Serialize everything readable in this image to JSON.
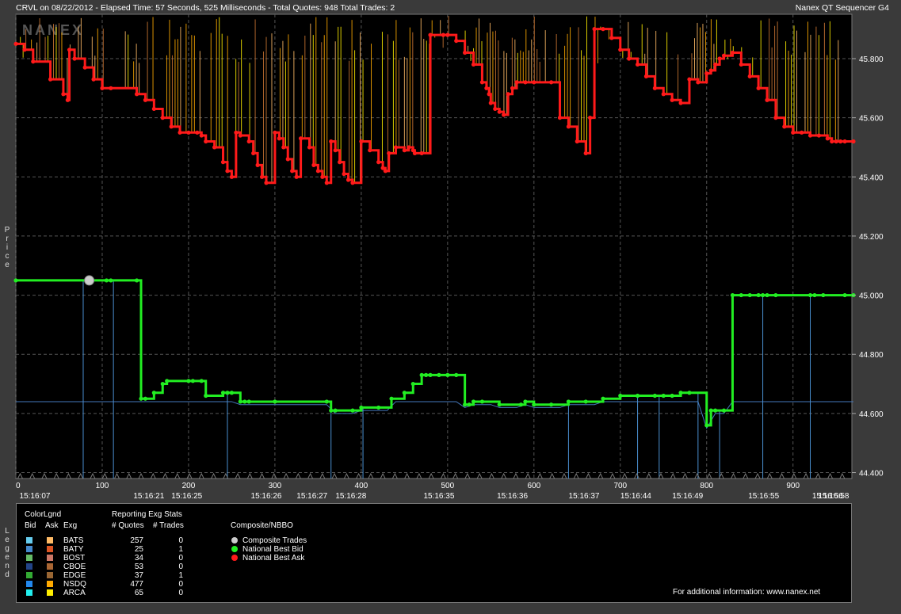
{
  "header": {
    "left": "CRVL on 08/22/2012  -  Elapsed Time: 57 Seconds, 525 Milliseconds  -  Total Quotes: 948  Total Trades: 2",
    "right": "Nanex QT Sequencer G4",
    "watermark": "NANEX"
  },
  "side_labels": {
    "price": "Price",
    "legend": "Legend"
  },
  "chart_data": {
    "type": "line",
    "xlim": [
      0,
      970
    ],
    "ylim": [
      44.38,
      45.95
    ],
    "ytick_values": [
      44.4,
      44.6,
      44.8,
      45.0,
      45.2,
      45.4,
      45.6,
      45.8
    ],
    "ytick_labels": [
      "44.400",
      "44.600",
      "44.800",
      "45.000",
      "45.200",
      "45.400",
      "45.600",
      "45.800"
    ],
    "xtick_values": [
      0,
      100,
      200,
      300,
      400,
      500,
      600,
      700,
      800,
      900
    ],
    "xtick_labels": [
      "0",
      "100",
      "200",
      "300",
      "400",
      "500",
      "600",
      "700",
      "800",
      "900"
    ],
    "time_tick_values": [
      8,
      154,
      198,
      290,
      343,
      388,
      490,
      575,
      658,
      718,
      778,
      866,
      940,
      985
    ],
    "time_labels": [
      "15:16:07",
      "15:16:21",
      "15:16:25",
      "15:16:26",
      "15:16:27",
      "15:16:28",
      "15:16:35",
      "15:16:36",
      "15:16:37",
      "15:16:44",
      "15:16:49",
      "15:16:55",
      "15:16:56",
      "15:16:58"
    ],
    "grid": true,
    "series": [
      {
        "name": "National Best Bid",
        "color": "#22ee22",
        "x": [
          0,
          105,
          110,
          140,
          145,
          150,
          160,
          170,
          175,
          200,
          205,
          215,
          220,
          240,
          245,
          250,
          260,
          265,
          270,
          300,
          360,
          365,
          370,
          390,
          400,
          420,
          435,
          450,
          460,
          470,
          475,
          480,
          490,
          500,
          510,
          520,
          525,
          530,
          540,
          560,
          585,
          590,
          600,
          620,
          640,
          660,
          680,
          700,
          720,
          740,
          750,
          760,
          770,
          780,
          800,
          805,
          810,
          820,
          830,
          840,
          850,
          860,
          865,
          870,
          880,
          920,
          925,
          935,
          960,
          970
        ],
        "y": [
          45.05,
          45.05,
          45.05,
          45.05,
          44.65,
          44.65,
          44.67,
          44.7,
          44.71,
          44.71,
          44.71,
          44.71,
          44.66,
          44.67,
          44.67,
          44.67,
          44.64,
          44.64,
          44.64,
          44.64,
          44.64,
          44.61,
          44.61,
          44.61,
          44.62,
          44.62,
          44.65,
          44.67,
          44.7,
          44.73,
          44.73,
          44.73,
          44.73,
          44.73,
          44.73,
          44.63,
          44.63,
          44.64,
          44.64,
          44.63,
          44.63,
          44.64,
          44.63,
          44.63,
          44.64,
          44.64,
          44.65,
          44.66,
          44.66,
          44.66,
          44.66,
          44.66,
          44.67,
          44.67,
          44.56,
          44.61,
          44.61,
          44.61,
          45.0,
          45.0,
          45.0,
          45.0,
          45.0,
          45.0,
          45.0,
          45.0,
          45.0,
          45.0,
          45.0,
          45.0
        ]
      },
      {
        "name": "National Best Ask",
        "color": "#ff1a1a",
        "x": [
          0,
          10,
          20,
          40,
          55,
          60,
          62,
          68,
          80,
          90,
          100,
          110,
          140,
          150,
          160,
          170,
          180,
          190,
          200,
          210,
          215,
          220,
          230,
          240,
          245,
          250,
          255,
          260,
          270,
          275,
          280,
          285,
          290,
          300,
          305,
          310,
          315,
          320,
          325,
          330,
          340,
          345,
          350,
          355,
          360,
          365,
          370,
          375,
          380,
          385,
          390,
          400,
          410,
          420,
          425,
          428,
          432,
          440,
          450,
          455,
          460,
          462,
          470,
          480,
          495,
          500,
          510,
          520,
          530,
          540,
          545,
          548,
          550,
          555,
          560,
          565,
          570,
          575,
          580,
          590,
          600,
          620,
          630,
          640,
          650,
          660,
          665,
          670,
          680,
          690,
          700,
          710,
          720,
          730,
          740,
          750,
          760,
          770,
          780,
          790,
          800,
          805,
          810,
          815,
          820,
          830,
          840,
          850,
          860,
          870,
          880,
          890,
          900,
          910,
          920,
          930,
          940,
          945,
          950,
          955,
          960,
          970
        ],
        "y": [
          45.85,
          45.83,
          45.79,
          45.73,
          45.68,
          45.66,
          45.83,
          45.8,
          45.77,
          45.73,
          45.7,
          45.7,
          45.68,
          45.66,
          45.63,
          45.6,
          45.57,
          45.55,
          45.55,
          45.55,
          45.54,
          45.52,
          45.5,
          45.45,
          45.42,
          45.4,
          45.55,
          45.54,
          45.52,
          45.48,
          45.44,
          45.4,
          45.38,
          45.55,
          45.53,
          45.5,
          45.46,
          45.42,
          45.4,
          45.53,
          45.5,
          45.44,
          45.42,
          45.4,
          45.38,
          45.52,
          45.49,
          45.45,
          45.41,
          45.39,
          45.38,
          45.52,
          45.49,
          45.45,
          45.43,
          45.42,
          45.48,
          45.5,
          45.49,
          45.5,
          45.49,
          45.48,
          45.48,
          45.88,
          45.88,
          45.88,
          45.86,
          45.82,
          45.78,
          45.72,
          45.7,
          45.68,
          45.65,
          45.63,
          45.62,
          45.61,
          45.68,
          45.7,
          45.72,
          45.72,
          45.72,
          45.72,
          45.6,
          45.57,
          45.52,
          45.48,
          45.6,
          45.9,
          45.9,
          45.87,
          45.83,
          45.8,
          45.78,
          45.74,
          45.7,
          45.68,
          45.66,
          45.65,
          45.73,
          45.72,
          45.75,
          45.76,
          45.78,
          45.8,
          45.81,
          45.82,
          45.78,
          45.74,
          45.7,
          45.66,
          45.6,
          45.57,
          45.55,
          45.55,
          45.54,
          45.54,
          45.53,
          45.52,
          45.52,
          45.52,
          45.52,
          45.52
        ]
      },
      {
        "name": "Composite Trades",
        "color": "#cccccc",
        "x": [
          85
        ],
        "y": [
          45.05
        ]
      }
    ]
  },
  "legend": {
    "title_colorlgnd": "ColorLgnd",
    "title_stats": "Reporting Exg Stats",
    "col_bid": "Bid",
    "col_ask": "Ask",
    "col_exg": "Exg",
    "col_quotes": "# Quotes",
    "col_trades": "# Trades",
    "composite_title": "Composite/NBBO",
    "rows": [
      {
        "exg": "BATS",
        "quotes": "257",
        "trades": "0",
        "bid_color": "#66ccee",
        "ask_color": "#ffbb66"
      },
      {
        "exg": "BATY",
        "quotes": "25",
        "trades": "1",
        "bid_color": "#4488cc",
        "ask_color": "#dd5522"
      },
      {
        "exg": "BOST",
        "quotes": "34",
        "trades": "0",
        "bid_color": "#66bb66",
        "ask_color": "#cc7766"
      },
      {
        "exg": "CBOE",
        "quotes": "53",
        "trades": "0",
        "bid_color": "#224488",
        "ask_color": "#aa6633"
      },
      {
        "exg": "EDGE",
        "quotes": "37",
        "trades": "1",
        "bid_color": "#33aa33",
        "ask_color": "#996633"
      },
      {
        "exg": "NSDQ",
        "quotes": "477",
        "trades": "0",
        "bid_color": "#2288ee",
        "ask_color": "#ffaa00"
      },
      {
        "exg": "ARCA",
        "quotes": "65",
        "trades": "0",
        "bid_color": "#22eeee",
        "ask_color": "#ffee00"
      }
    ],
    "composite": [
      {
        "label": "Composite Trades",
        "color": "#cccccc"
      },
      {
        "label": "National Best Bid",
        "color": "#22ee22"
      },
      {
        "label": "National Best Ask",
        "color": "#ff1a1a"
      }
    ],
    "footer": "For additional information: www.nanex.net"
  }
}
